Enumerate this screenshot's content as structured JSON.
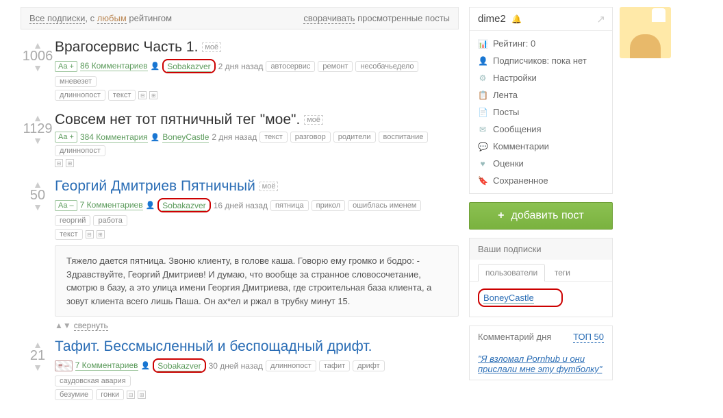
{
  "filter": {
    "all_subs": "Все подписки",
    "with": ", с ",
    "any": "любым",
    "rating": " рейтингом",
    "collapse": "сворачивать",
    "viewed": " просмотренные посты"
  },
  "posts": [
    {
      "votes": "1006",
      "title": "Врагосервис Часть 1.",
      "title_link": false,
      "mytag": "моё",
      "aa": "Aa +",
      "aa_class": "aa",
      "comments": "86 Комментариев",
      "author": "Sobakazver",
      "author_circled": true,
      "time": "2 дня назад",
      "tags": [
        "автосервис",
        "ремонт",
        "несобачьедело",
        "мневезет"
      ],
      "tags2": [
        "длиннопост",
        "текст"
      ],
      "minis": true
    },
    {
      "votes": "1129",
      "title": "Совсем нет тот пятничный тег \"мое\".",
      "title_link": false,
      "mytag": "моё",
      "aa": "Aa +",
      "aa_class": "aa",
      "comments": "384 Комментария",
      "author": "BoneyCastle",
      "author_circled": false,
      "time": "2 дня назад",
      "tags": [
        "текст",
        "разговор",
        "родители",
        "воспитание",
        "длиннопост"
      ],
      "minis": true
    },
    {
      "votes": "50",
      "title": "Георгий Дмитриев Пятничный",
      "title_link": true,
      "mytag": "моё",
      "aa": "Aa –",
      "aa_class": "aa minus",
      "comments": "7 Комментариев",
      "author": "Sobakazver",
      "author_circled": true,
      "time": "16 дней назад",
      "tags": [
        "пятница",
        "прикол",
        "ошиблась именем",
        "георгий",
        "работа"
      ],
      "tags2": [
        "текст"
      ],
      "minis": true,
      "excerpt": "Тяжело дается пятница. Звоню клиенту, в голове каша. Говорю ему громко и бодро: - Здравствуйте, Георгий Дмитриев! И думаю, что вообще за странное словосочетание, смотрю в базу, а это улица имени Георгия Дмитриева, где строительная база клиента, а зовут клиента всего лишь Паша. Он ах*ел и ржал в трубку минут 15.",
      "collapse": "свернуть"
    },
    {
      "votes": "21",
      "title": "Тафит. Бессмысленный и беспощадный дрифт.",
      "title_link": true,
      "aa": "≡ –",
      "aa_class": "aa striped",
      "comments": "7 Комментариев",
      "author": "Sobakazver",
      "author_circled": true,
      "time": "30 дней назад",
      "tags": [
        "длиннопост",
        "тафит",
        "дрифт",
        "саудовская авария"
      ],
      "tags2": [
        "безумие",
        "гонки"
      ],
      "minis": true
    }
  ],
  "user": {
    "name": "dime2",
    "rows": [
      {
        "icon": "📊",
        "text": "Рейтинг: 0"
      },
      {
        "icon": "👤",
        "text": "Подписчиков: пока нет"
      },
      {
        "icon": "⚙",
        "text": "Настройки"
      },
      {
        "icon": "📋",
        "text": "Лента"
      },
      {
        "icon": "📄",
        "text": "Посты"
      },
      {
        "icon": "✉",
        "text": "Сообщения"
      },
      {
        "icon": "💬",
        "text": "Комментарии"
      },
      {
        "icon": "♥",
        "text": "Оценки"
      },
      {
        "icon": "🔖",
        "text": "Сохраненное"
      }
    ]
  },
  "addpost": "добавить пост",
  "subs": {
    "title": "Ваши подписки",
    "tab_users": "пользователи",
    "tab_tags": "теги",
    "link": "BoneyCastle"
  },
  "comday": {
    "title": "Комментарий дня",
    "top": "ТОП 50",
    "text": "\"Я взломал Pornhub и они прислали мне эту футболку\""
  }
}
